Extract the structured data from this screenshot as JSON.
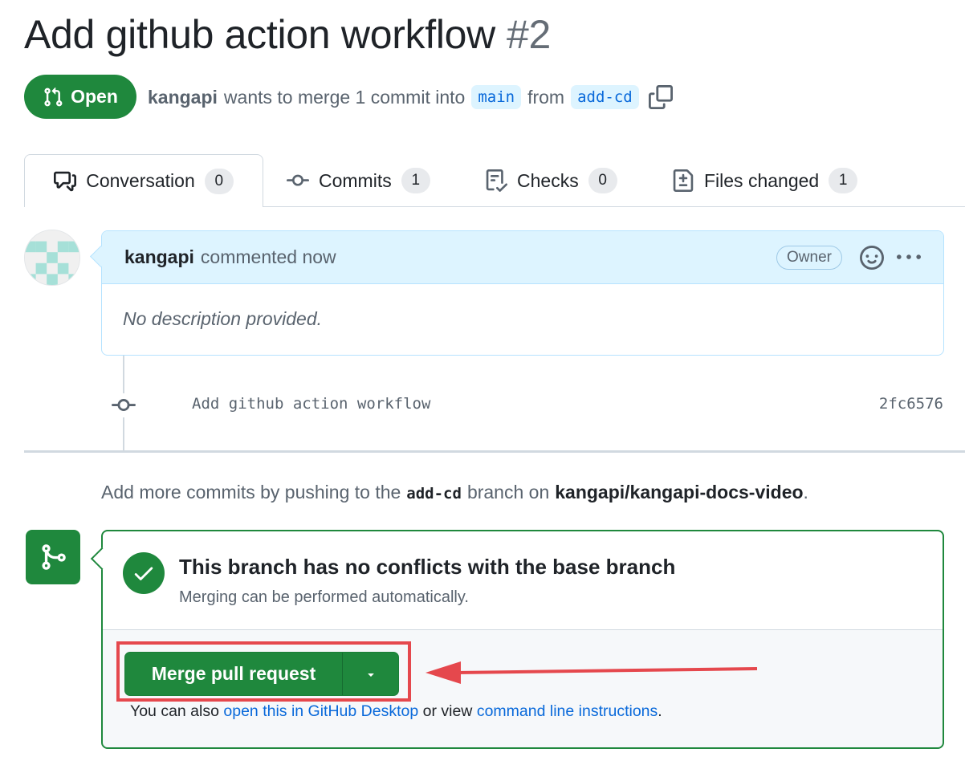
{
  "pr": {
    "title": "Add github action workflow",
    "number": "#2",
    "state": "Open",
    "author": "kangapi",
    "summary_pre": "wants to merge 1 commit into",
    "base_branch": "main",
    "from_word": "from",
    "head_branch": "add-cd"
  },
  "tabs": [
    {
      "label": "Conversation",
      "count": "0",
      "icon": "comment-discussion-icon"
    },
    {
      "label": "Commits",
      "count": "1",
      "icon": "git-commit-icon"
    },
    {
      "label": "Checks",
      "count": "0",
      "icon": "checklist-icon"
    },
    {
      "label": "Files changed",
      "count": "1",
      "icon": "file-diff-icon"
    }
  ],
  "comment": {
    "author": "kangapi",
    "action": "commented now",
    "role_badge": "Owner",
    "body": "No description provided."
  },
  "commit": {
    "message": "Add github action workflow",
    "sha": "2fc6576"
  },
  "hint": {
    "pre": "Add more commits by pushing to the",
    "branch": "add-cd",
    "mid": "branch on",
    "repo": "kangapi/kangapi-docs-video",
    "end": "."
  },
  "merge": {
    "title": "This branch has no conflicts with the base branch",
    "subtitle": "Merging can be performed automatically.",
    "button_label": "Merge pull request",
    "also_pre": "You can also",
    "desktop_link": "open this in GitHub Desktop",
    "also_mid": "or view",
    "cli_link": "command line instructions",
    "also_end": "."
  },
  "colors": {
    "success": "#1f883d",
    "link": "#0969da",
    "annotation": "#e5484d",
    "comment_header_bg": "#ddf4ff"
  }
}
